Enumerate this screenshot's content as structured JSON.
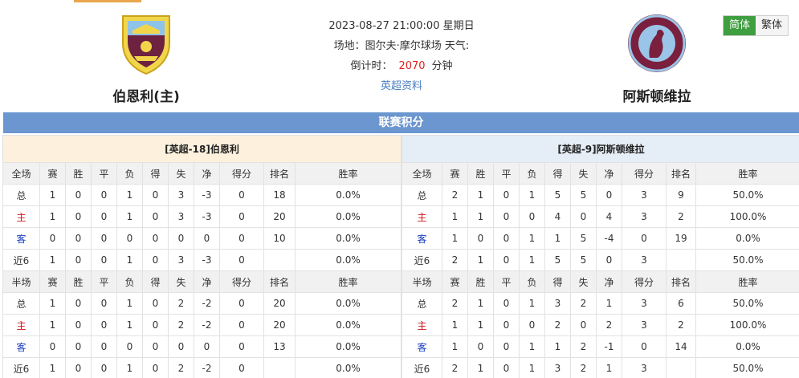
{
  "match": {
    "datetime": "2023-08-27 21:00:00 星期日",
    "venue_line": "场地：图尔夫·摩尔球场 天气:",
    "countdown_label": "倒计时：",
    "countdown_value": "2070",
    "countdown_unit": "分钟",
    "league_link": "英超资料"
  },
  "home_team": {
    "name": "伯恩利(主)"
  },
  "away_team": {
    "name": "阿斯顿维拉"
  },
  "lang": {
    "simplified": "简体",
    "traditional": "繁体"
  },
  "section_title": "联赛积分",
  "colors": {
    "accent_green": "#3f9e3f",
    "title_blue": "#6b96cf",
    "countdown_red": "#e02020",
    "home_red": "#d0141a",
    "away_blue": "#1a3fbf"
  },
  "home_panel": {
    "title": "[英超-18]伯恩利",
    "full_header": [
      "全场",
      "赛",
      "胜",
      "平",
      "负",
      "得",
      "失",
      "净",
      "得分",
      "排名",
      "胜率"
    ],
    "full_rows": [
      [
        "总",
        "1",
        "0",
        "0",
        "1",
        "0",
        "3",
        "-3",
        "0",
        "18",
        "0.0%"
      ],
      [
        "主",
        "1",
        "0",
        "0",
        "1",
        "0",
        "3",
        "-3",
        "0",
        "20",
        "0.0%"
      ],
      [
        "客",
        "0",
        "0",
        "0",
        "0",
        "0",
        "0",
        "0",
        "0",
        "10",
        "0.0%"
      ],
      [
        "近6",
        "1",
        "0",
        "0",
        "1",
        "0",
        "3",
        "-3",
        "0",
        "",
        "0.0%"
      ]
    ],
    "half_header": [
      "半场",
      "赛",
      "胜",
      "平",
      "负",
      "得",
      "失",
      "净",
      "得分",
      "排名",
      "胜率"
    ],
    "half_rows": [
      [
        "总",
        "1",
        "0",
        "0",
        "1",
        "0",
        "2",
        "-2",
        "0",
        "20",
        "0.0%"
      ],
      [
        "主",
        "1",
        "0",
        "0",
        "1",
        "0",
        "2",
        "-2",
        "0",
        "20",
        "0.0%"
      ],
      [
        "客",
        "0",
        "0",
        "0",
        "0",
        "0",
        "0",
        "0",
        "0",
        "13",
        "0.0%"
      ],
      [
        "近6",
        "1",
        "0",
        "0",
        "1",
        "0",
        "2",
        "-2",
        "0",
        "",
        "0.0%"
      ]
    ]
  },
  "away_panel": {
    "title": "[英超-9]阿斯顿维拉",
    "full_header": [
      "全场",
      "赛",
      "胜",
      "平",
      "负",
      "得",
      "失",
      "净",
      "得分",
      "排名",
      "胜率"
    ],
    "full_rows": [
      [
        "总",
        "2",
        "1",
        "0",
        "1",
        "5",
        "5",
        "0",
        "3",
        "9",
        "50.0%"
      ],
      [
        "主",
        "1",
        "1",
        "0",
        "0",
        "4",
        "0",
        "4",
        "3",
        "2",
        "100.0%"
      ],
      [
        "客",
        "1",
        "0",
        "0",
        "1",
        "1",
        "5",
        "-4",
        "0",
        "19",
        "0.0%"
      ],
      [
        "近6",
        "2",
        "1",
        "0",
        "1",
        "5",
        "5",
        "0",
        "3",
        "",
        "50.0%"
      ]
    ],
    "half_header": [
      "半场",
      "赛",
      "胜",
      "平",
      "负",
      "得",
      "失",
      "净",
      "得分",
      "排名",
      "胜率"
    ],
    "half_rows": [
      [
        "总",
        "2",
        "1",
        "0",
        "1",
        "3",
        "2",
        "1",
        "3",
        "6",
        "50.0%"
      ],
      [
        "主",
        "1",
        "1",
        "0",
        "0",
        "2",
        "0",
        "2",
        "3",
        "2",
        "100.0%"
      ],
      [
        "客",
        "1",
        "0",
        "0",
        "1",
        "1",
        "2",
        "-1",
        "0",
        "14",
        "0.0%"
      ],
      [
        "近6",
        "2",
        "1",
        "0",
        "1",
        "3",
        "2",
        "1",
        "3",
        "",
        "50.0%"
      ]
    ]
  }
}
